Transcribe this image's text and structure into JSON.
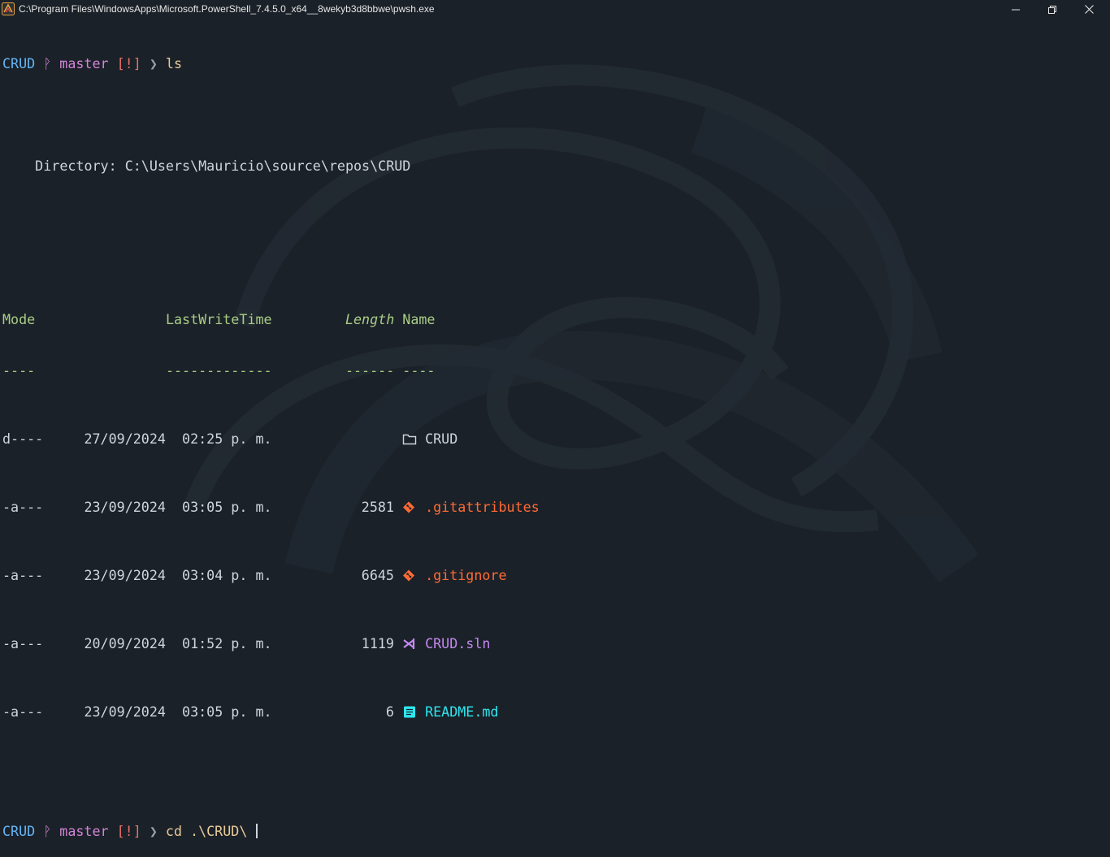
{
  "window": {
    "title": "C:\\Program Files\\WindowsApps\\Microsoft.PowerShell_7.4.5.0_x64__8wekyb3d8bbwe\\pwsh.exe",
    "controls": {
      "minimize": "minimize",
      "maximize": "maximize",
      "close": "close"
    }
  },
  "prompt1": {
    "folder": "CRUD",
    "branch": "master",
    "status": "[!]",
    "arrow": "❯",
    "command": "ls"
  },
  "listing": {
    "directory_label": "    Directory: ",
    "directory_path": "C:\\Users\\Mauricio\\source\\repos\\CRUD",
    "headers": {
      "mode": "Mode",
      "time": "LastWriteTime",
      "length": "Length",
      "name": "Name"
    },
    "underlines": {
      "mode": "----",
      "time": "-------------",
      "length": "------",
      "name": "----"
    },
    "rows": [
      {
        "mode": "d----",
        "date": "27/09/2024",
        "time": "02:25 p. m.",
        "length": "",
        "name": "CRUD",
        "icon": "folder-icon"
      },
      {
        "mode": "-a---",
        "date": "23/09/2024",
        "time": "03:05 p. m.",
        "length": "2581",
        "name": ".gitattributes",
        "icon": "git-icon"
      },
      {
        "mode": "-a---",
        "date": "23/09/2024",
        "time": "03:04 p. m.",
        "length": "6645",
        "name": ".gitignore",
        "icon": "git-icon"
      },
      {
        "mode": "-a---",
        "date": "20/09/2024",
        "time": "01:52 p. m.",
        "length": "1119",
        "name": "CRUD.sln",
        "icon": "visual-studio-icon"
      },
      {
        "mode": "-a---",
        "date": "23/09/2024",
        "time": "03:05 p. m.",
        "length": "6",
        "name": "README.md",
        "icon": "readme-icon"
      }
    ]
  },
  "prompt2": {
    "folder": "CRUD",
    "branch": "master",
    "status": "[!]",
    "arrow": "❯",
    "command": "cd .\\CRUD\\ "
  },
  "colors": {
    "background": "#1b2128",
    "folder": "#64b5f6",
    "branch": "#d385d8",
    "status": "#e8716a",
    "header": "#a8cd86",
    "git_file": "#ff6b35",
    "sln_file": "#c388f0",
    "md_file": "#2ee6f0"
  }
}
